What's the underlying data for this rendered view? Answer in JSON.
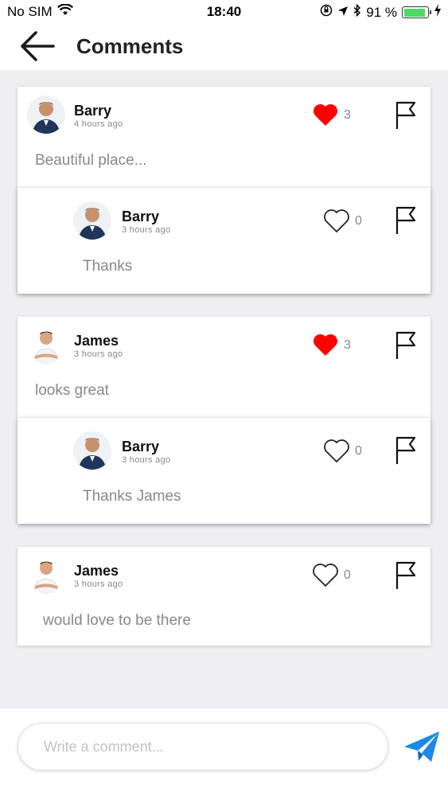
{
  "status_bar": {
    "carrier": "No SIM",
    "time": "18:40",
    "battery_text": "91 %",
    "battery_level": 0.91
  },
  "header": {
    "title": "Comments"
  },
  "comments": [
    {
      "author": "Barry",
      "time": "4 hours ago",
      "text": "Beautiful place...",
      "likes": "3",
      "liked": true,
      "reply": {
        "author": "Barry",
        "time": "3 hours ago",
        "text": "Thanks",
        "likes": "0",
        "liked": false
      }
    },
    {
      "author": "James",
      "time": "3 hours ago",
      "text": "looks great",
      "likes": "3",
      "liked": true,
      "reply": {
        "author": "Barry",
        "time": "3 hours ago",
        "text": "Thanks James",
        "likes": "0",
        "liked": false
      }
    },
    {
      "author": "James",
      "time": "3 hours ago",
      "text": "would love to be there",
      "likes": "0",
      "liked": false
    }
  ],
  "composer": {
    "placeholder": "Write a comment..."
  },
  "colors": {
    "like_active": "#ff0000",
    "send_accent": "#1a8ae6",
    "battery": "#4cd964"
  },
  "icons": {
    "back": "arrow-left-icon",
    "like_filled": "heart-filled-icon",
    "like_outline": "heart-outline-icon",
    "flag": "flag-icon",
    "send": "paper-plane-icon",
    "wifi": "wifi-icon",
    "location": "location-arrow-icon",
    "bluetooth": "bluetooth-icon",
    "orientation_lock": "orientation-lock-icon",
    "charging": "charging-bolt-icon"
  }
}
